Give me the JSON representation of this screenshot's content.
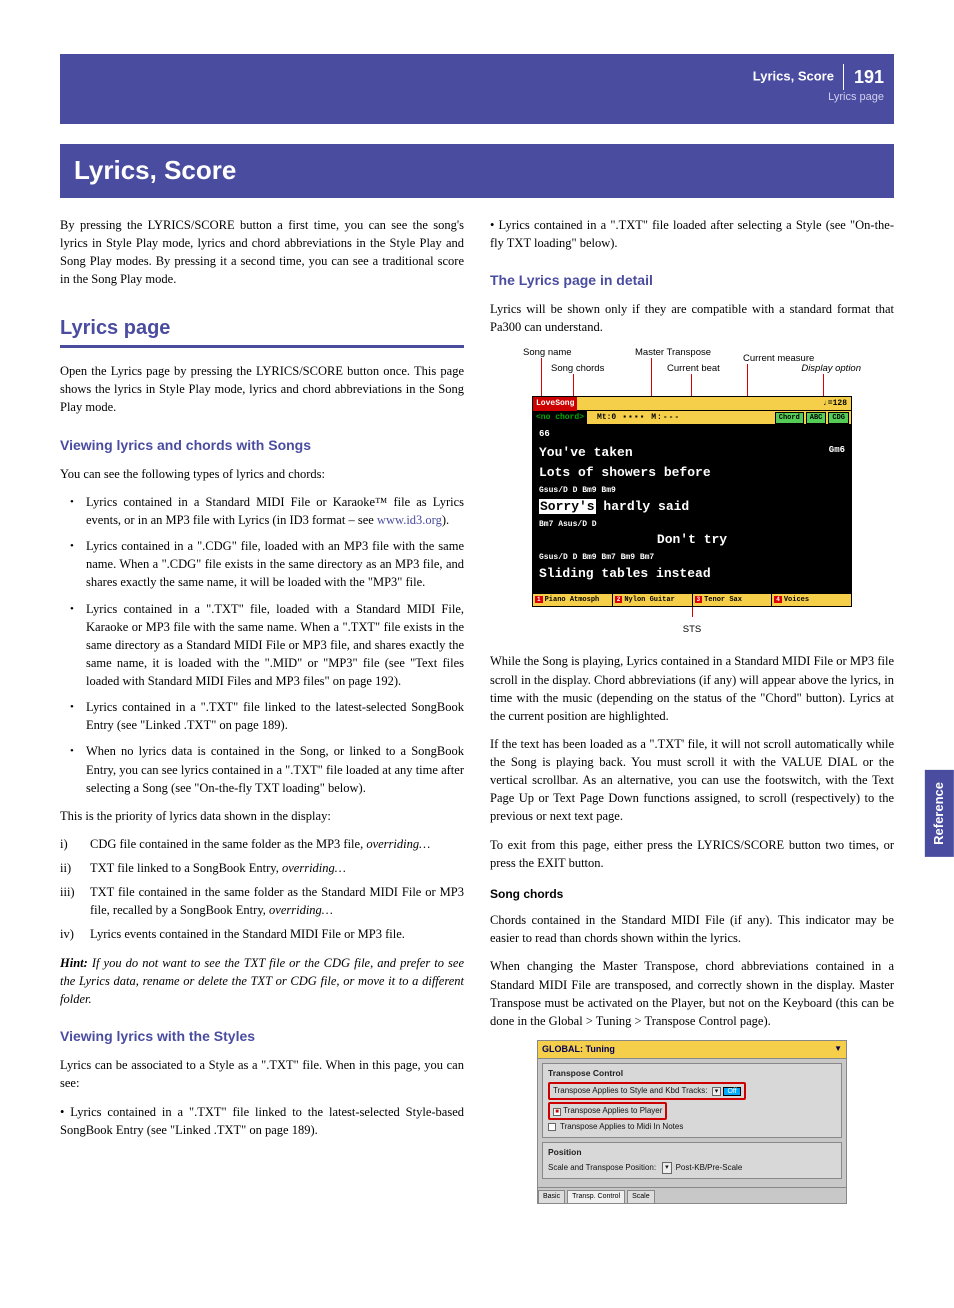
{
  "header": {
    "section": "Lyrics, Score",
    "subsection": "Lyrics page",
    "page_number": "191"
  },
  "title": "Lyrics, Score",
  "intro": "By pressing the LYRICS/SCORE button a first time, you can see the song's lyrics in Style Play mode, lyrics and chord abbreviations in the Style Play and Song Play modes. By pressing it a second time, you can see a traditional score in the Song Play mode.",
  "h2_lyrics_page": "Lyrics page",
  "p_lyrics_open": "Open the Lyrics page by pressing the LYRICS/SCORE button once. This page shows the lyrics in Style Play mode, lyrics and chord abbreviations in the Song Play mode.",
  "h3_viewing_songs": "Viewing lyrics and chords with Songs",
  "p_types_intro": "You can see the following types of lyrics and chords:",
  "bullets_songs": [
    {
      "pre": "Lyrics contained in a Standard MIDI File or Karaoke™ file as Lyrics events, or in an MP3 file with Lyrics (in ID3 format – see ",
      "link": "www.id3.org",
      "post": ")."
    },
    {
      "text": "Lyrics contained in a \".CDG\" file, loaded with an MP3 file with the same name. When a \".CDG\" file exists in the same directory as an MP3 file, and shares exactly the same name, it will be loaded with the \"MP3\" file."
    },
    {
      "text": "Lyrics contained in a \".TXT\" file, loaded with a Standard MIDI File, Karaoke or MP3 file with the same name. When a \".TXT\" file exists in the same directory as a Standard MIDI File or MP3 file, and shares exactly the same name, it is loaded with the \".MID\" or \"MP3\" file (see \"Text files loaded with Standard MIDI Files and MP3 files\" on page 192)."
    },
    {
      "text": "Lyrics contained in a \".TXT\" file linked to the latest-selected SongBook Entry (see \"Linked .TXT\" on page 189)."
    },
    {
      "text": "When no lyrics data is contained in the Song, or linked to a SongBook Entry, you can see lyrics contained in a \".TXT\" file loaded at any time after selecting a Song (see \"On-the-fly TXT loading\" below)."
    }
  ],
  "p_priority": "This is the priority of lyrics data shown in the display:",
  "roman_list": [
    {
      "num": "i)",
      "pre": "CDG file contained in the same folder as the MP3 file, ",
      "it": "overriding…"
    },
    {
      "num": "ii)",
      "pre": "TXT file linked to a SongBook Entry, ",
      "it": "overriding…"
    },
    {
      "num": "iii)",
      "pre": "TXT file contained in the same folder as the Standard MIDI File or MP3 file, recalled by a SongBook Entry, ",
      "it": "overriding…"
    },
    {
      "num": "iv)",
      "pre": "Lyrics events contained in the Standard MIDI File or MP3 file.",
      "it": ""
    }
  ],
  "hint": {
    "b": "Hint:",
    "text": " If you do not want to see the TXT file or the CDG file, and prefer to see the Lyrics data, rename or delete the TXT or CDG file, or move it to a different folder."
  },
  "h3_viewing_styles": "Viewing lyrics with the Styles",
  "p_styles_intro": "Lyrics can be associated to a Style as a \".TXT\" file. When in this page, you can see:",
  "p_styles_b1": "• Lyrics contained in a \".TXT\" file linked to the latest-selected Style-based SongBook Entry (see \"Linked .TXT\" on page 189).",
  "p_styles_b2": "• Lyrics contained in a \".TXT\" file loaded after selecting a Style (see \"On-the-fly TXT loading\" below).",
  "h3_detail": "The Lyrics page in detail",
  "p_detail_intro": "Lyrics will be shown only if they are compatible with a standard format that Pa300 can understand.",
  "callouts": {
    "song_name": "Song name",
    "song_chords": "Song chords",
    "master_transpose": "Master Transpose",
    "current_beat": "Current beat",
    "current_measure": "Current measure",
    "display_option": "Display option",
    "sts": "STS"
  },
  "lyrics_screen": {
    "songname": "LoveSong",
    "tempo": "♩=128",
    "nochord": "<no chord>",
    "mt": "Mt:0",
    "beats": "▪▪▪▪  M:---",
    "buttons": [
      "Chord",
      "ABC",
      "CDG"
    ],
    "measure": "66",
    "l1": "You've taken",
    "l1_rc": "Gm6",
    "l2": "Lots of showers before",
    "c2": "Gsus/D        D                              Bm9   Bm9",
    "l3_hl": "Sorry's",
    "l3_rest": " hardly said",
    "c3": "Bm7   Asus/D    D",
    "l4": "Don't try",
    "c4": "Gsus/D      D                Bm9   Bm7      Bm9   Bm7",
    "l5": "Sliding tables instead",
    "sts": [
      {
        "n": "1",
        "t": "Piano Atmosph"
      },
      {
        "n": "2",
        "t": "Nylon Guitar"
      },
      {
        "n": "3",
        "t": "Tenor Sax"
      },
      {
        "n": "4",
        "t": "Voices"
      }
    ]
  },
  "p_detail_1": "While the Song is playing, Lyrics contained in a Standard MIDI File or MP3 file scroll in the display. Chord abbreviations (if any) will appear above the lyrics, in time with the music (depending on the status of the \"Chord\" button). Lyrics at the current position are highlighted.",
  "p_detail_2": "If the text has been loaded as a \".TXT' file, it will not scroll automatically while the Song is playing back. You must scroll it with the VALUE DIAL or the vertical scrollbar. As an alternative, you can use the footswitch, with the Text Page Up or Text Page Down functions assigned, to scroll (respectively) to the previous or next text page.",
  "p_detail_3": "To exit from this page, either press the LYRICS/SCORE button two times, or press the EXIT button.",
  "h4_song_chords": "Song chords",
  "p_songchords_1": "Chords contained in the Standard MIDI File (if any). This indicator may be easier to read than chords shown within the lyrics.",
  "p_songchords_2": "When changing the Master Transpose, chord abbreviations contained in a Standard MIDI File are transposed, and correctly shown in the display. Master Transpose must be activated on the Player, but not on the Keyboard (this can be done in the Global > Tuning > Transpose Control page).",
  "global_fig": {
    "title": "GLOBAL: Tuning",
    "panel1_title": "Transpose Control",
    "row1": "Transpose Applies to Style and Kbd Tracks:",
    "row1_val": "Off",
    "row2": "Transpose Applies to Player",
    "row3": "Transpose Applies to Midi In Notes",
    "panel2_title": "Position",
    "row4": "Scale and Transpose Position:",
    "row4_val": "Post-KB/Pre-Scale",
    "tabs": [
      "Basic",
      "Transp. Control",
      "Scale"
    ]
  },
  "side_tab": "Reference"
}
